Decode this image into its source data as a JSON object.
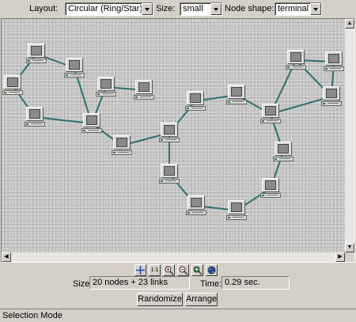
{
  "toolbar": {
    "layout_label": "Layout:",
    "layout_value": "Circular (Ring/Star)",
    "size_label": "Size:",
    "size_value": "small",
    "node_shape_label": "Node shape:",
    "node_shape_value": "terminal"
  },
  "graph": {
    "edge_color": "#2e7070",
    "node_icon": "terminal-computer-icon",
    "node_count": 20,
    "link_count": 23
  },
  "icon_toolbar": {
    "buttons": [
      {
        "name": "selection-cross-icon"
      },
      {
        "name": "zoom-1-to-1-icon",
        "label": "1:1"
      },
      {
        "name": "zoom-in-icon"
      },
      {
        "name": "zoom-out-icon"
      },
      {
        "name": "zoom-fit-icon"
      },
      {
        "name": "globe-overview-icon"
      }
    ]
  },
  "info": {
    "size_label": "Size:",
    "size_value": "20 nodes + 23 links",
    "time_label": "Time:",
    "time_value": "0.29 sec."
  },
  "buttons": {
    "randomize": "Randomize",
    "arrange": "Arrange"
  },
  "status": {
    "text": "Selection Mode"
  }
}
